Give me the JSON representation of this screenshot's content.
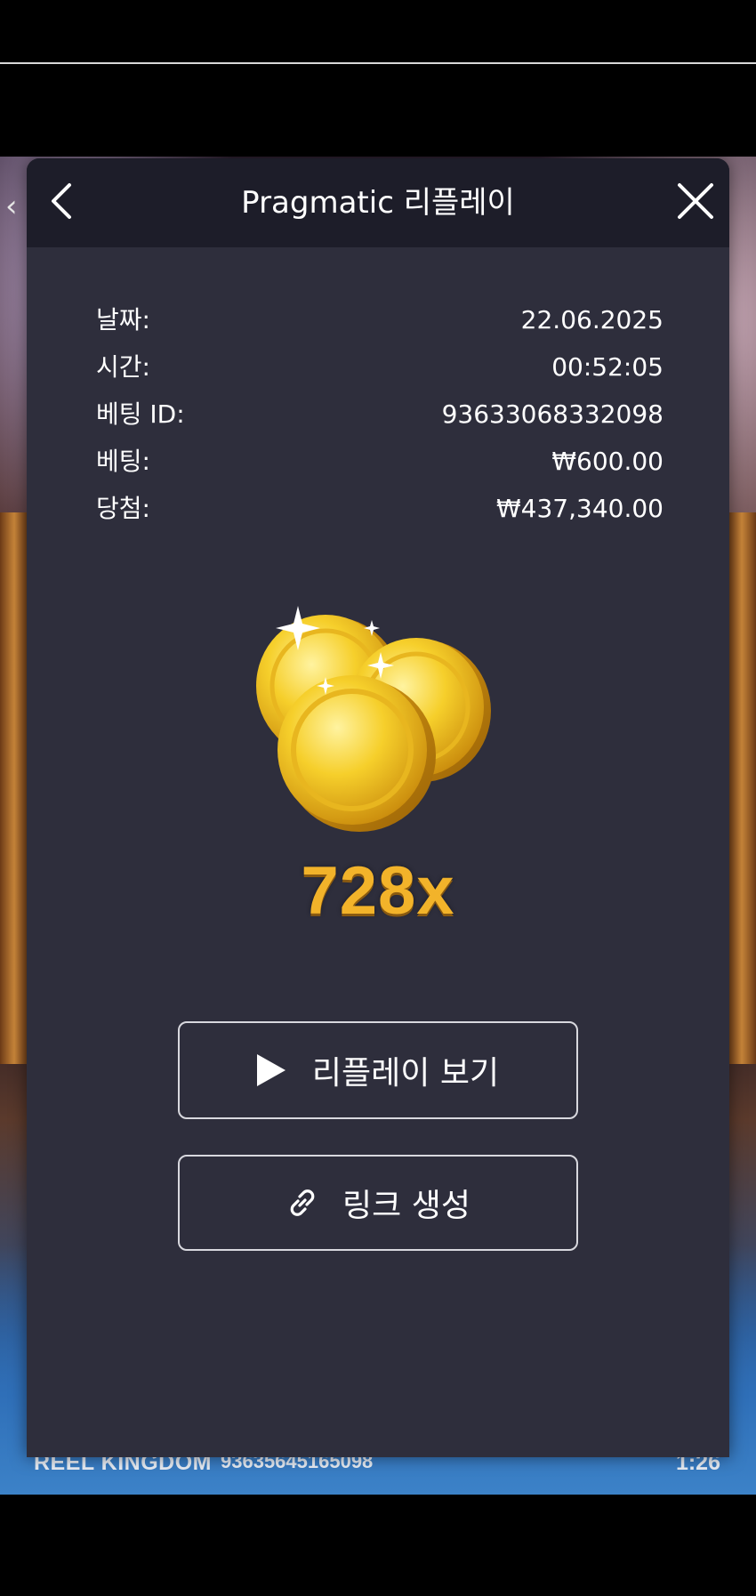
{
  "dialog": {
    "title": "Pragmatic 리플레이"
  },
  "details": [
    {
      "label": "날짜:",
      "value": "22.06.2025"
    },
    {
      "label": "시간:",
      "value": "00:52:05"
    },
    {
      "label": "베팅 ID:",
      "value": "93633068332098"
    },
    {
      "label": "베팅:",
      "value": "₩600.00"
    },
    {
      "label": "당첨:",
      "value": "₩437,340.00"
    }
  ],
  "win": {
    "multiplier": "728x"
  },
  "buttons": {
    "replay_label": "리플레이 보기",
    "link_label": "링크 생성"
  },
  "footer": {
    "brand": "REEL KINGDOM",
    "round_id": "93635645165098",
    "time": "1:26"
  },
  "colors": {
    "dialog_bg": "#2e2e3c",
    "header_bg": "#1d1d29",
    "multiplier": "#f2b32a"
  }
}
